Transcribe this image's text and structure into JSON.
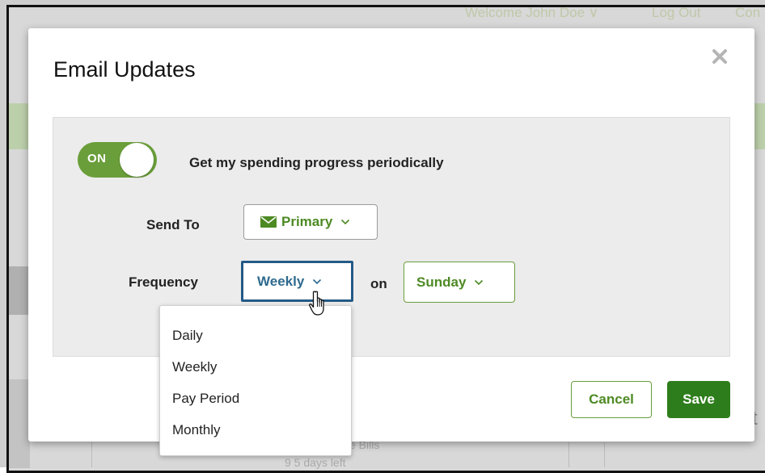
{
  "background": {
    "welcome_text": "Welcome John Doe ∨",
    "logout_text": "Log Out",
    "contact_text": "Con",
    "lower_text_1": "e Bills",
    "lower_text_2": "9 5 days left",
    "side_text": "t"
  },
  "modal": {
    "title": "Email Updates",
    "close_icon": "close-icon"
  },
  "toggle": {
    "state_label": "ON",
    "is_on": true,
    "description": "Get my spending progress periodically"
  },
  "send_to": {
    "label": "Send To",
    "value": "Primary",
    "icon": "envelope-icon"
  },
  "frequency": {
    "label": "Frequency",
    "value": "Weekly",
    "on_label": "on",
    "day_value": "Sunday",
    "options": [
      "Daily",
      "Weekly",
      "Pay Period",
      "Monthly"
    ]
  },
  "footer": {
    "cancel_label": "Cancel",
    "save_label": "Save"
  },
  "colors": {
    "accent_green": "#6a9e3a",
    "save_green": "#2e7d1c",
    "focus_blue": "#245a86",
    "panel_gray": "#ececec"
  }
}
